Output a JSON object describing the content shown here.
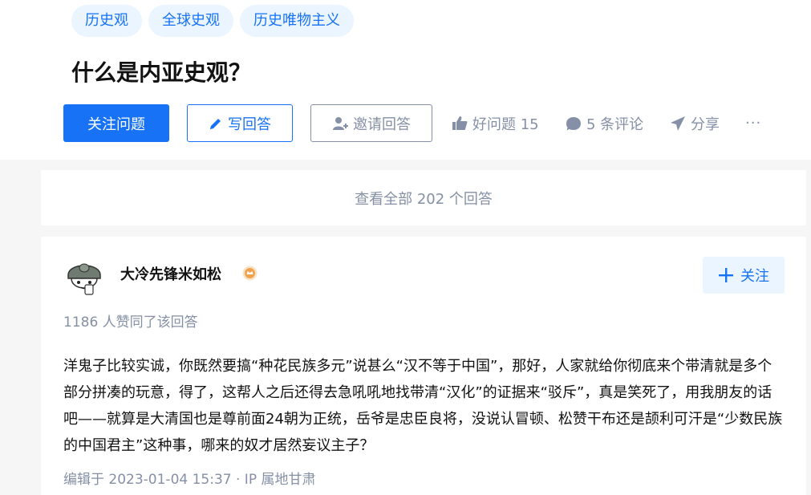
{
  "topics": [
    "历史观",
    "全球史观",
    "历史唯物主义"
  ],
  "question": {
    "title": "什么是内亚史观？"
  },
  "actions": {
    "follow_label": "关注问题",
    "write_label": "写回答",
    "invite_label": "邀请回答",
    "good_question_label": "好问题 15",
    "comments_label": "5 条评论",
    "share_label": "分享",
    "more_label": "···"
  },
  "view_all_label": "查看全部 202 个回答",
  "answer": {
    "author_name": "大冷先锋米如松",
    "follow_label": "关注",
    "vote_text": "1186 人赞同了该回答",
    "content": "洋鬼子比较实诚，你既然要搞“种花民族多元”说甚么“汉不等于中国”，那好，人家就给你彻底来个带清就是多个部分拼凑的玩意，得了，这帮人之后还得去急吼吼地找带清“汉化”的证据来“驳斥”，真是笑死了，用我朋友的话吧——就算是大清国也是尊前面24朝为正统，岳爷是忠臣良将，没说认冒顿、松赞干布还是颉利可汗是“少数民族的中国君主”这种事，哪来的奴才居然妄议主子？",
    "edit_info": "编辑于 2023-01-04 15:37 · IP 属地甘肃"
  },
  "colors": {
    "brand_blue": "#1772f6",
    "tag_bg": "#ebf5ff",
    "meta_gray": "#8590a6",
    "page_bg": "#f6f6f6",
    "badge_orange": "#f0a24e"
  },
  "icons": {
    "write": "pencil-icon",
    "invite": "add-user-icon",
    "good_question": "thumbs-up-icon",
    "comments": "comment-bubble-icon",
    "share": "paper-plane-icon",
    "more": "more-dots-icon",
    "badge": "creator-badge-icon",
    "follow": "plus-icon"
  }
}
